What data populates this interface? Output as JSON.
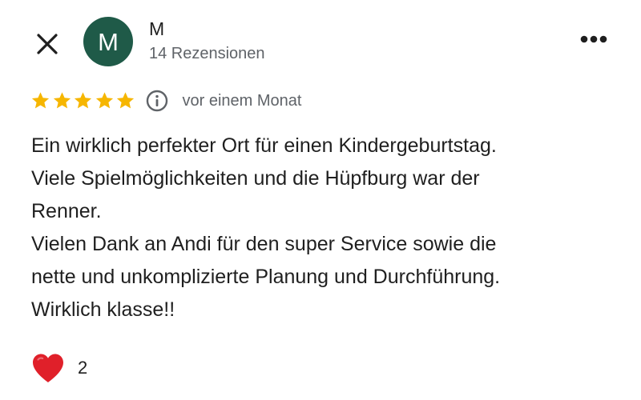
{
  "review": {
    "author": {
      "initial": "M",
      "name": "M",
      "review_count": "14 Rezensionen",
      "avatar_color": "#1f5a48"
    },
    "rating": {
      "stars": 5,
      "max": 5,
      "star_color": "#f6b600"
    },
    "date": "vor einem Monat",
    "text_lines": [
      "Ein wirklich perfekter Ort für einen Kindergeburtstag.",
      "Viele Spielmöglichkeiten und die Hüpfburg war der",
      "Renner.",
      "Vielen Dank an Andi für den super Service sowie die",
      "nette und unkomplizierte Planung und Durchführung.",
      "Wirklich klasse!!"
    ],
    "reaction": {
      "icon": "heart-icon",
      "count": "2",
      "color": "#e0202a"
    }
  },
  "toolbar": {
    "close_icon": "close-icon",
    "more_icon": "more-options-icon"
  }
}
